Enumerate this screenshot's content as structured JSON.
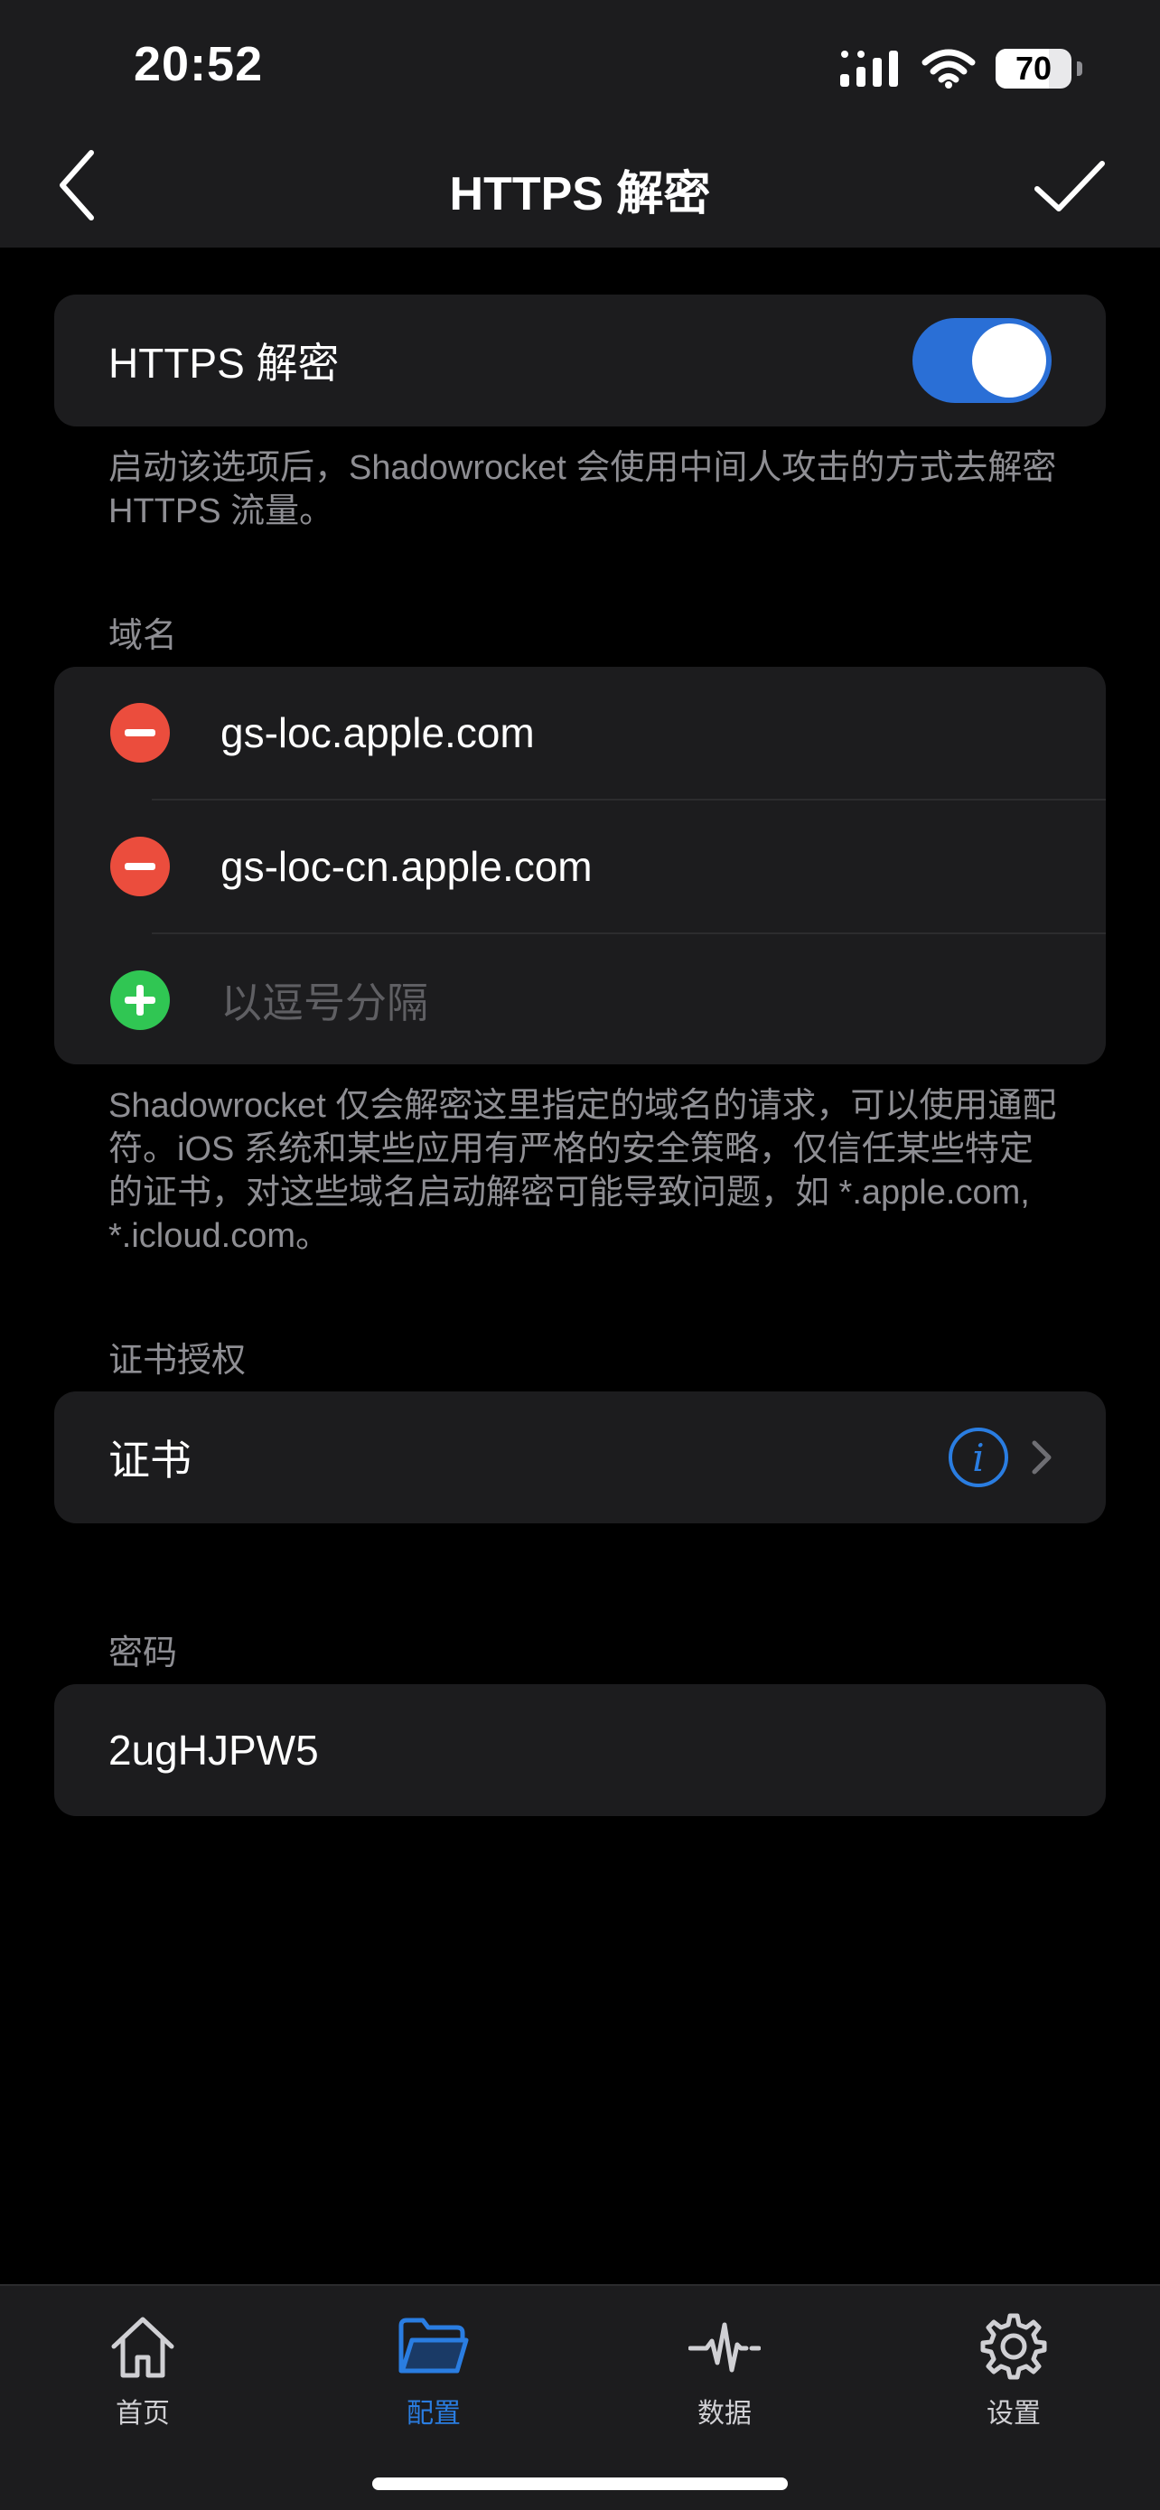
{
  "status_bar": {
    "time": "20:52",
    "battery": "70",
    "battery_level": 0.7
  },
  "nav": {
    "title": "HTTPS 解密"
  },
  "https_toggle": {
    "label": "HTTPS 解密",
    "enabled": true,
    "accent": "#2a6fd6"
  },
  "https_description": "启动该选项后，Shadowrocket 会使用中间人攻击的方式去解密 HTTPS 流量。",
  "domains": {
    "header": "域名",
    "items": [
      {
        "label": "gs-loc.apple.com"
      },
      {
        "label": "gs-loc-cn.apple.com"
      }
    ],
    "add_placeholder": "以逗号分隔",
    "description": "Shadowrocket 仅会解密这里指定的域名的请求，可以使用通配符。iOS 系统和某些应用有严格的安全策略，仅信任某些特定的证书，对这些域名启动解密可能导致问题，如 *.apple.com, *.icloud.com。"
  },
  "certificate": {
    "header": "证书授权",
    "label": "证书"
  },
  "password": {
    "header": "密码",
    "value": "2ugHJPW5"
  },
  "tabbar": {
    "items": [
      {
        "label": "首页",
        "icon": "house-icon",
        "active": false
      },
      {
        "label": "配置",
        "icon": "folder-icon",
        "active": true
      },
      {
        "label": "数据",
        "icon": "waveform-icon",
        "active": false
      },
      {
        "label": "设置",
        "icon": "gear-icon",
        "active": false
      }
    ],
    "active_color": "#2a7de1"
  }
}
